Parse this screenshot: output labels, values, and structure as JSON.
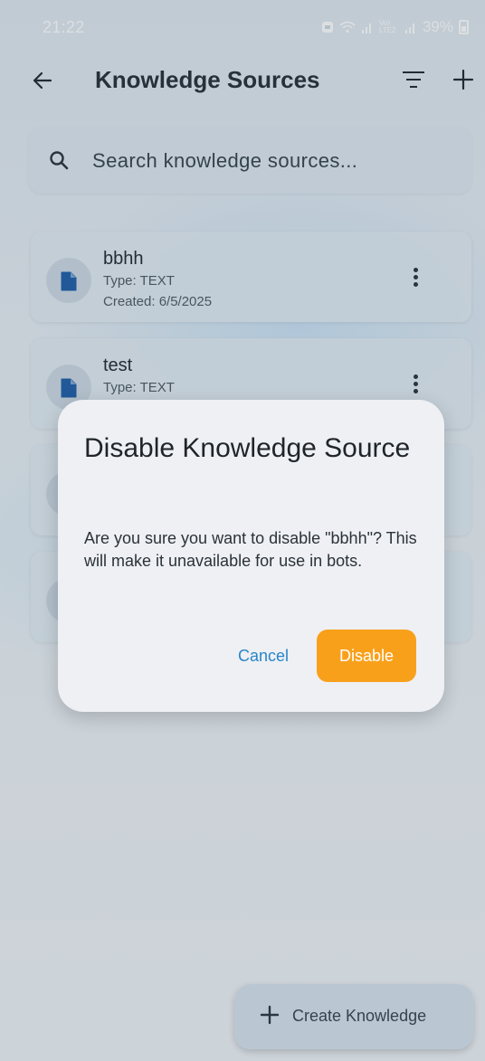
{
  "status_bar": {
    "time": "21:22",
    "signal_text": "Vo) LTE2",
    "battery_percent": "39%"
  },
  "app_bar": {
    "title": "Knowledge Sources"
  },
  "search": {
    "placeholder": "Search knowledge sources..."
  },
  "cards": [
    {
      "title": "bbhh",
      "type": "Type: TEXT",
      "created": "Created: 6/5/2025"
    },
    {
      "title": "test",
      "type": "Type: TEXT",
      "created": ""
    }
  ],
  "dialog": {
    "title": "Disable Knowledge Source",
    "body": "Are you sure you want to disable \"bbhh\"? This will make it unavailable for use in bots.",
    "cancel_label": "Cancel",
    "confirm_label": "Disable"
  },
  "fab": {
    "label": "Create Knowledge"
  },
  "colors": {
    "accent": "#f9a01b",
    "link": "#2a86c8",
    "file_icon": "#1f5fa8"
  },
  "icons": [
    "back-arrow-icon",
    "filter-icon",
    "plus-icon",
    "search-icon",
    "file-icon",
    "more-vert-icon",
    "wifi-icon",
    "signal-icon",
    "battery-icon"
  ]
}
